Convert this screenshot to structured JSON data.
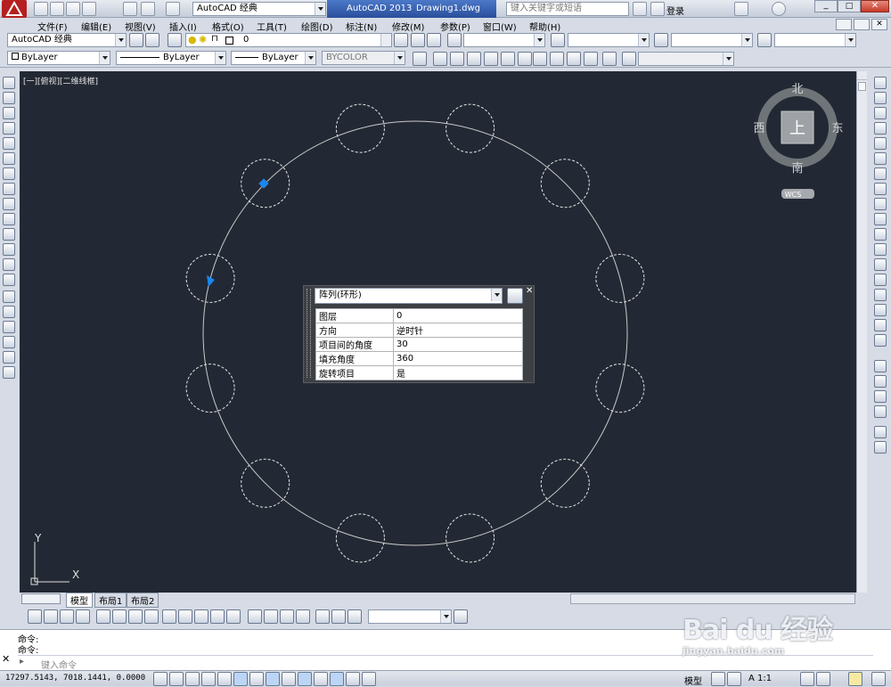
{
  "title": {
    "workspace": "AutoCAD 经典",
    "app": "AutoCAD 2013",
    "file": "Drawing1.dwg",
    "search_placeholder": "键入关键字或短语",
    "login": "登录"
  },
  "menu": [
    "文件(F)",
    "编辑(E)",
    "视图(V)",
    "插入(I)",
    "格式(O)",
    "工具(T)",
    "绘图(D)",
    "标注(N)",
    "修改(M)",
    "参数(P)",
    "窗口(W)",
    "帮助(H)"
  ],
  "toolbar1": {
    "workspace": "AutoCAD 经典",
    "layer": "0"
  },
  "toolbar2": {
    "color": "ByLayer",
    "linetype": "ByLayer",
    "lineweight": "ByLayer",
    "plotstyle": "BYCOLOR"
  },
  "viewport_label": "[一][俯视][二维线框]",
  "viewcube": {
    "north": "北",
    "south": "南",
    "east": "东",
    "west": "西",
    "face": "上",
    "wcs": "WCS"
  },
  "ucs": {
    "x": "X",
    "y": "Y"
  },
  "property_panel": {
    "object_type": "阵列(环形)",
    "rows": [
      {
        "label": "图层",
        "value": "0"
      },
      {
        "label": "方向",
        "value": "逆时针"
      },
      {
        "label": "项目间的角度",
        "value": "30"
      },
      {
        "label": "填充角度",
        "value": "360"
      },
      {
        "label": "旋转项目",
        "value": "是"
      }
    ]
  },
  "layout_tabs": [
    "模型",
    "布局1",
    "布局2"
  ],
  "command": {
    "line1": "命令:",
    "line2": "命令:",
    "placeholder": "键入命令"
  },
  "status": {
    "coords": "17297.5143,  7018.1441,  0.0000",
    "model": "模型",
    "scale": "A 1:1"
  },
  "watermark": {
    "brand": "Bai du 经验",
    "url": "jingyan.baidu.com"
  },
  "colors": {
    "canvas": "#232934",
    "grip": "#1a86f0",
    "chrome": "#d6dbe5"
  }
}
